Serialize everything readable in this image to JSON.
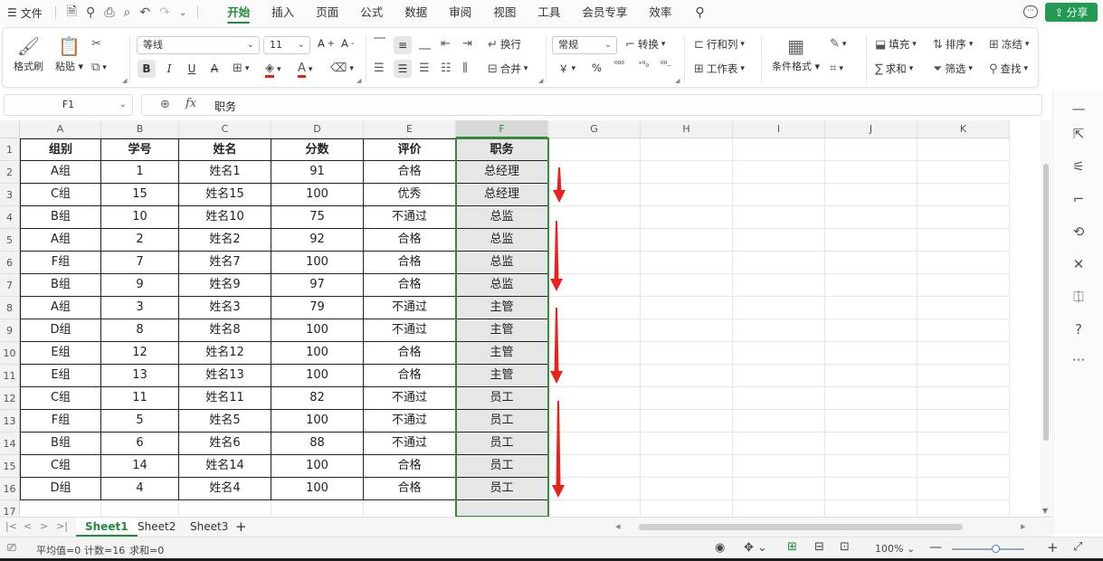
{
  "menubar": {
    "file_label": "文件",
    "tabs": [
      "开始",
      "插入",
      "页面",
      "公式",
      "数据",
      "审阅",
      "视图",
      "工具",
      "会员专享",
      "效率"
    ],
    "active_tab": "开始",
    "share_label": "分享"
  },
  "ribbon": {
    "format_painter": "格式刷",
    "paste": "粘贴",
    "font_name": "等线",
    "font_size": "11",
    "bold": "B",
    "italic": "I",
    "underline": "U",
    "strike": "A",
    "wrap": "换行",
    "merge": "合并",
    "number_format": "常规",
    "convert": "转换",
    "rows_cols": "行和列",
    "worksheet": "工作表",
    "conditional_format": "条件格式",
    "fill": "填充",
    "sort": "排序",
    "freeze": "冻结",
    "sum": "求和",
    "filter": "筛选",
    "find": "查找",
    "currency": "￥",
    "percent": "%"
  },
  "formula_bar": {
    "name_box": "F1",
    "fx": "fx",
    "value": "职务"
  },
  "columns": [
    "A",
    "B",
    "C",
    "D",
    "E",
    "F",
    "G",
    "H",
    "I",
    "J",
    "K"
  ],
  "selected_column": "F",
  "table": {
    "headers": [
      "组别",
      "学号",
      "姓名",
      "分数",
      "评价",
      "职务"
    ],
    "rows": [
      [
        "A组",
        "1",
        "姓名1",
        "91",
        "合格",
        "总经理"
      ],
      [
        "C组",
        "15",
        "姓名15",
        "100",
        "优秀",
        "总经理"
      ],
      [
        "B组",
        "10",
        "姓名10",
        "75",
        "不通过",
        "总监"
      ],
      [
        "A组",
        "2",
        "姓名2",
        "92",
        "合格",
        "总监"
      ],
      [
        "F组",
        "7",
        "姓名7",
        "100",
        "合格",
        "总监"
      ],
      [
        "B组",
        "9",
        "姓名9",
        "97",
        "合格",
        "总监"
      ],
      [
        "A组",
        "3",
        "姓名3",
        "79",
        "不通过",
        "主管"
      ],
      [
        "D组",
        "8",
        "姓名8",
        "100",
        "不通过",
        "主管"
      ],
      [
        "E组",
        "12",
        "姓名12",
        "100",
        "合格",
        "主管"
      ],
      [
        "E组",
        "13",
        "姓名13",
        "100",
        "合格",
        "主管"
      ],
      [
        "C组",
        "11",
        "姓名11",
        "82",
        "不通过",
        "员工"
      ],
      [
        "F组",
        "5",
        "姓名5",
        "100",
        "不通过",
        "员工"
      ],
      [
        "B组",
        "6",
        "姓名6",
        "88",
        "不通过",
        "员工"
      ],
      [
        "C组",
        "14",
        "姓名14",
        "100",
        "合格",
        "员工"
      ],
      [
        "D组",
        "4",
        "姓名4",
        "100",
        "合格",
        "员工"
      ]
    ]
  },
  "row_numbers": [
    "1",
    "2",
    "3",
    "4",
    "5",
    "6",
    "7",
    "8",
    "9",
    "10",
    "11",
    "12",
    "13",
    "14",
    "15",
    "16",
    "17"
  ],
  "sheets": [
    "Sheet1",
    "Sheet2",
    "Sheet3"
  ],
  "active_sheet": "Sheet1",
  "status": {
    "average": "平均值=0",
    "count": "计数=16",
    "sum": "求和=0",
    "zoom": "100%"
  },
  "colors": {
    "accent": "#218a3b",
    "arrow": "#e8231c",
    "share_bg": "#219a52"
  }
}
